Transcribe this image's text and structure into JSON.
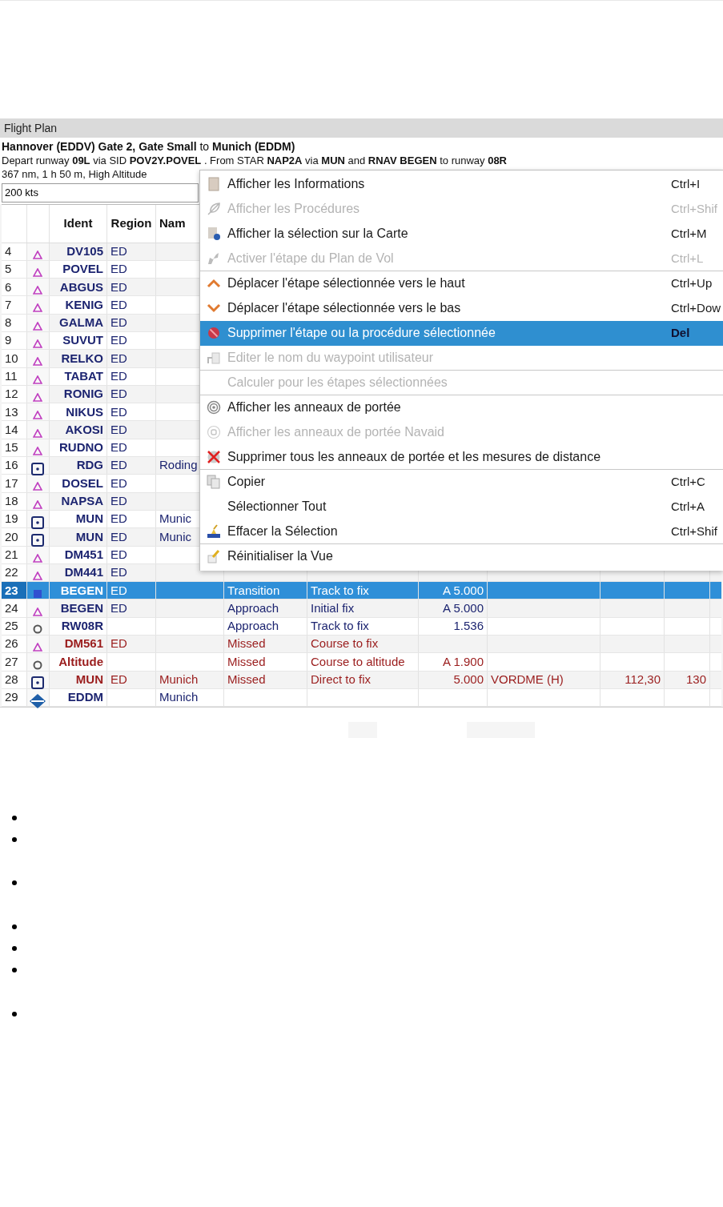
{
  "panel_title": "Flight Plan",
  "route_title": "**Hannover (EDDV) Gate 2, Gate Small** to **Munich (EDDM)**",
  "route_detail": "Depart runway **09L** via SID **POV2Y.POVEL** . From STAR **NAP2A** via **MUN** and **RNAV BEGEN** to runway **08R**",
  "route_summary": "367 nm, 1 h 50 m, High Altitude",
  "speed_field": {
    "value": "200 kts"
  },
  "table": {
    "ident_header": "Ident",
    "region_header": "Region",
    "name_header": "Nam",
    "rows": [
      {
        "number": "4",
        "kind": "waypoint",
        "ident": "DV105",
        "region": "ED",
        "missed": false,
        "selected": false
      },
      {
        "number": "5",
        "kind": "waypoint",
        "ident": "POVEL",
        "region": "ED",
        "missed": false,
        "selected": false
      },
      {
        "number": "6",
        "kind": "waypoint",
        "ident": "ABGUS",
        "region": "ED",
        "missed": false,
        "selected": false
      },
      {
        "number": "7",
        "kind": "waypoint",
        "ident": "KENIG",
        "region": "ED",
        "missed": false,
        "selected": false
      },
      {
        "number": "8",
        "kind": "waypoint",
        "ident": "GALMA",
        "region": "ED",
        "missed": false,
        "selected": false
      },
      {
        "number": "9",
        "kind": "waypoint",
        "ident": "SUVUT",
        "region": "ED",
        "missed": false,
        "selected": false
      },
      {
        "number": "10",
        "kind": "waypoint",
        "ident": "RELKO",
        "region": "ED",
        "missed": false,
        "selected": false
      },
      {
        "number": "11",
        "kind": "waypoint",
        "ident": "TABAT",
        "region": "ED",
        "missed": false,
        "selected": false
      },
      {
        "number": "12",
        "kind": "waypoint",
        "ident": "RONIG",
        "region": "ED",
        "missed": false,
        "selected": false
      },
      {
        "number": "13",
        "kind": "waypoint",
        "ident": "NIKUS",
        "region": "ED",
        "missed": false,
        "selected": false
      },
      {
        "number": "14",
        "kind": "waypoint",
        "ident": "AKOSI",
        "region": "ED",
        "missed": false,
        "selected": false
      },
      {
        "number": "15",
        "kind": "waypoint",
        "ident": "RUDNO",
        "region": "ED",
        "missed": false,
        "selected": false
      },
      {
        "number": "16",
        "kind": "vordme",
        "ident": "RDG",
        "region": "ED",
        "name": "Roding",
        "missed": false,
        "selected": false
      },
      {
        "number": "17",
        "kind": "waypoint",
        "ident": "DOSEL",
        "region": "ED",
        "missed": false,
        "selected": false
      },
      {
        "number": "18",
        "kind": "waypoint",
        "ident": "NAPSA",
        "region": "ED",
        "missed": false,
        "selected": false
      },
      {
        "number": "19",
        "kind": "vordme",
        "ident": "MUN",
        "region": "ED",
        "name": "Munic",
        "missed": false,
        "selected": false
      },
      {
        "number": "20",
        "kind": "vordme",
        "ident": "MUN",
        "region": "ED",
        "name": "Munic",
        "missed": false,
        "selected": false
      },
      {
        "number": "21",
        "kind": "waypoint",
        "ident": "DM451",
        "region": "ED",
        "missed": false,
        "selected": false
      },
      {
        "number": "22",
        "kind": "waypoint",
        "ident": "DM441",
        "region": "ED",
        "missed": false,
        "selected": false
      },
      {
        "number": "23",
        "kind": "waypoint",
        "ident": "BEGEN",
        "region": "ED",
        "procedure": "Transition",
        "leg_type": "Track to fix",
        "restriction": "A 5.000",
        "missed": false,
        "selected": true
      },
      {
        "number": "24",
        "kind": "waypoint",
        "ident": "BEGEN",
        "region": "ED",
        "procedure": "Approach",
        "leg_type": "Initial fix",
        "restriction": "A 5.000",
        "missed": false,
        "selected": false
      },
      {
        "number": "25",
        "kind": "point",
        "ident": "RW08R",
        "procedure": "Approach",
        "leg_type": "Track to fix",
        "restriction": "1.536",
        "missed": false,
        "selected": false
      },
      {
        "number": "26",
        "kind": "waypoint",
        "ident": "DM561",
        "region": "ED",
        "procedure": "Missed",
        "leg_type": "Course to fix",
        "missed": true,
        "selected": false
      },
      {
        "number": "27",
        "kind": "point",
        "ident": "Altitude",
        "procedure": "Missed",
        "leg_type": "Course to altitude",
        "restriction": "A 1.900",
        "missed": true,
        "selected": false
      },
      {
        "number": "28",
        "kind": "vordme",
        "ident": "MUN",
        "region": "ED",
        "name": "Munich",
        "procedure": "Missed",
        "leg_type": "Direct to fix",
        "restriction": "5.000",
        "navaid": "VORDME (H)",
        "frequency": "112,30",
        "range": "130",
        "missed": true,
        "selected": false
      },
      {
        "number": "29",
        "kind": "airport",
        "ident": "EDDM",
        "name": "Munich",
        "missed": false,
        "selected": false
      }
    ]
  },
  "context_menu": {
    "items": [
      {
        "kind": "document",
        "label": "Afficher les Informations",
        "shortcut": "Ctrl+I",
        "disabled": false,
        "selected": false,
        "separator_after": false
      },
      {
        "kind": "feather",
        "label": "Afficher les Procédures",
        "shortcut": "Ctrl+Shif",
        "disabled": true,
        "selected": false,
        "separator_after": false
      },
      {
        "kind": "globe",
        "label": "Afficher la sélection sur la Carte",
        "shortcut": "Ctrl+M",
        "disabled": false,
        "selected": false,
        "separator_after": false
      },
      {
        "kind": "plane",
        "label": "Activer l'étape du Plan de Vol",
        "shortcut": "Ctrl+L",
        "disabled": true,
        "selected": false,
        "separator_after": true
      },
      {
        "kind": "up",
        "label": "Déplacer l'étape sélectionnée vers le haut",
        "shortcut": "Ctrl+Up",
        "disabled": false,
        "selected": false,
        "separator_after": false
      },
      {
        "kind": "down",
        "label": "Déplacer l'étape sélectionnée vers le bas",
        "shortcut": "Ctrl+Dow",
        "disabled": false,
        "selected": false,
        "separator_after": false
      },
      {
        "kind": "forbidden",
        "label": "Supprimer l'étape ou la procédure sélectionnée",
        "shortcut": "Del",
        "disabled": false,
        "selected": true,
        "separator_after": false
      },
      {
        "kind": "edit",
        "label": "Editer le nom du waypoint utilisateur",
        "disabled": true,
        "selected": false,
        "separator_after": true
      },
      {
        "kind": "plain",
        "label": "Calculer pour les étapes sélectionnées",
        "disabled": true,
        "selected": false,
        "separator_after": true
      },
      {
        "kind": "rings",
        "label": "Afficher les anneaux de portée",
        "disabled": false,
        "selected": false,
        "separator_after": false
      },
      {
        "kind": "ring",
        "label": "Afficher les anneaux de portée Navaid",
        "disabled": true,
        "selected": false,
        "separator_after": false
      },
      {
        "kind": "cross",
        "label": "Supprimer tous les anneaux de portée et les mesures de distance",
        "disabled": false,
        "selected": false,
        "separator_after": true
      },
      {
        "kind": "copy",
        "label": "Copier",
        "shortcut": "Ctrl+C",
        "disabled": false,
        "selected": false,
        "separator_after": false
      },
      {
        "kind": "plain",
        "label": "Sélectionner Tout",
        "shortcut": "Ctrl+A",
        "disabled": false,
        "selected": false,
        "separator_after": false
      },
      {
        "kind": "broom",
        "label": "Effacer la Sélection",
        "shortcut": "Ctrl+Shif",
        "disabled": false,
        "selected": false,
        "separator_after": true
      },
      {
        "kind": "pencil",
        "label": "Réinitialiser la Vue",
        "disabled": false,
        "selected": false,
        "separator_after": false
      }
    ]
  }
}
